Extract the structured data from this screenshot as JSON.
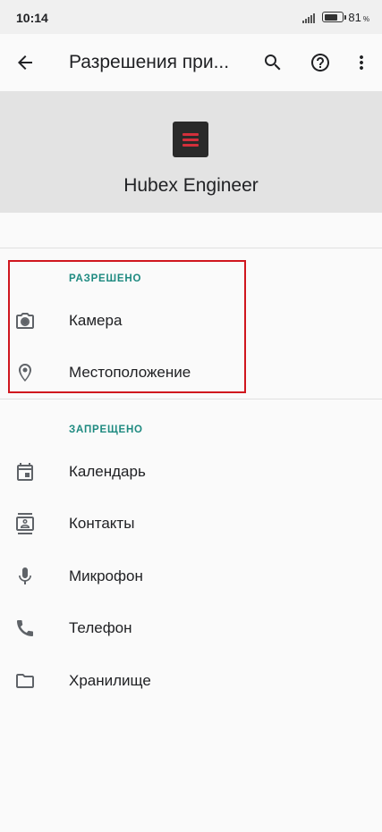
{
  "status_bar": {
    "time": "10:14",
    "battery_level": 81,
    "battery_unit": "%"
  },
  "toolbar": {
    "title": "Разрешения при...",
    "back_icon": "arrow-back-icon",
    "search_icon": "search-icon",
    "help_icon": "help-icon",
    "more_icon": "more-vert-icon"
  },
  "app": {
    "name": "Hubex Engineer",
    "icon": "hubex-app-icon",
    "icon_bg_color": "#2a2a2a",
    "icon_accent_color": "#d3303b"
  },
  "allowed": {
    "label": "РАЗРЕШЕНО",
    "items": [
      {
        "label": "Камера",
        "icon": "camera-icon"
      },
      {
        "label": "Местоположение",
        "icon": "location-icon"
      }
    ]
  },
  "denied": {
    "label": "ЗАПРЕЩЕНО",
    "items": [
      {
        "label": "Календарь",
        "icon": "calendar-icon"
      },
      {
        "label": "Контакты",
        "icon": "contacts-icon"
      },
      {
        "label": "Микрофон",
        "icon": "microphone-icon"
      },
      {
        "label": "Телефон",
        "icon": "phone-icon"
      },
      {
        "label": "Хранилище",
        "icon": "folder-icon"
      }
    ]
  },
  "colors": {
    "section_label": "#1e8a80",
    "highlight": "#d0161e"
  }
}
